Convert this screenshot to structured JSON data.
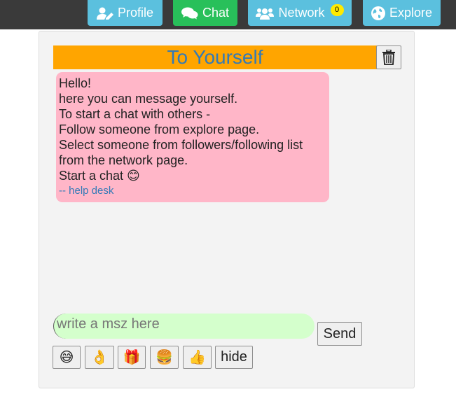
{
  "nav": {
    "profile": {
      "label": "Profile",
      "icon": "user-edit-icon"
    },
    "chat": {
      "label": "Chat",
      "icon": "comments-icon"
    },
    "network": {
      "label": "Network",
      "icon": "users-icon",
      "badge": "0"
    },
    "explore": {
      "label": "Explore",
      "icon": "globe-icon"
    }
  },
  "chat": {
    "title": "To Yourself",
    "delete_icon": "trash-icon",
    "message": {
      "lines": [
        "Hello!",
        "here you can message yourself.",
        "To start a chat with others -",
        "Follow someone from explore page.",
        "Select someone from followers/following list",
        "from the network page.",
        "Start a chat 😊"
      ],
      "signature": "-- help desk"
    }
  },
  "composer": {
    "placeholder": "write a msz here",
    "value": "",
    "send_label": "Send"
  },
  "emoji_bar": {
    "emojis": [
      "😅",
      "👌",
      "🎁",
      "🍔",
      "👍"
    ],
    "hide_label": "hide"
  },
  "colors": {
    "topbar": "#3a3a3a",
    "info": "#5bc0de",
    "success": "#28c05a",
    "title_bg": "#ffa500",
    "title_text": "#337ab7",
    "bubble_bg": "#ffb6c8",
    "input_bg": "#d4ffcc",
    "badge": "#ffea00"
  }
}
